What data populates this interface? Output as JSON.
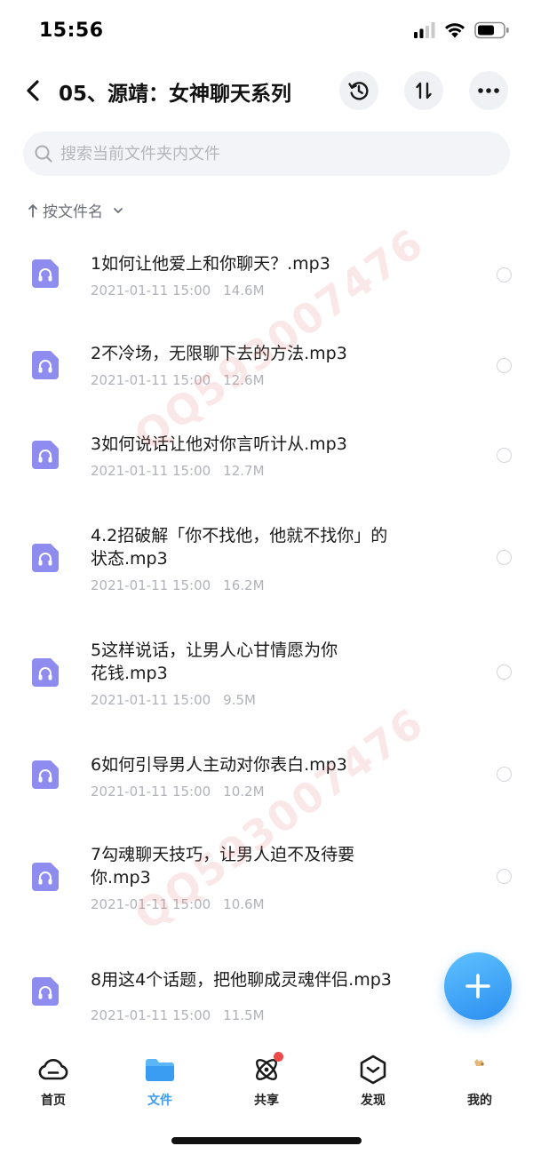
{
  "status_bar": {
    "time": "15:56"
  },
  "header": {
    "title": "05、源靖：女神聊天系列"
  },
  "search": {
    "placeholder": "搜索当前文件夹内文件"
  },
  "sort": {
    "label": "按文件名"
  },
  "files": [
    {
      "name": "1如何让他爱上和你聊天？.mp3",
      "date": "2021-01-11 15:00",
      "size": "14.6M"
    },
    {
      "name": "2不冷场，无限聊下去的方法.mp3",
      "date": "2021-01-11 15:00",
      "size": "12.6M"
    },
    {
      "name": "3如何说话让他对你言听计从.mp3",
      "date": "2021-01-11 15:00",
      "size": "12.7M"
    },
    {
      "name": "4.2招破解「你不找他，他就不找你」的\n状态.mp3",
      "date": "2021-01-11 15:00",
      "size": "16.2M"
    },
    {
      "name": "5这样说话，让男人心甘情愿为你\n花钱.mp3",
      "date": "2021-01-11 15:00",
      "size": "9.5M"
    },
    {
      "name": "6如何引导男人主动对你表白.mp3",
      "date": "2021-01-11 15:00",
      "size": "10.2M"
    },
    {
      "name": "7勾魂聊天技巧，让男人迫不及待要\n你.mp3",
      "date": "2021-01-11 15:00",
      "size": "10.6M"
    },
    {
      "name": "8用这4个话题，把他聊成灵魂伴侣.mp3",
      "date": "2021-01-11 15:00",
      "size": "11.5M"
    }
  ],
  "watermark": {
    "text": "QQ593007476"
  },
  "tabbar": {
    "tabs": [
      {
        "label": "首页",
        "icon": "cloud-icon",
        "active": false
      },
      {
        "label": "文件",
        "icon": "folder-icon",
        "active": true
      },
      {
        "label": "共享",
        "icon": "atom-icon",
        "active": false,
        "badge": true
      },
      {
        "label": "发现",
        "icon": "discover-icon",
        "active": false
      },
      {
        "label": "我的",
        "icon": "avatar-icon",
        "active": false
      }
    ]
  },
  "colors": {
    "accent": "#3a9df2",
    "file_icon": "#8f8cf0",
    "badge": "#ef4a4a"
  }
}
